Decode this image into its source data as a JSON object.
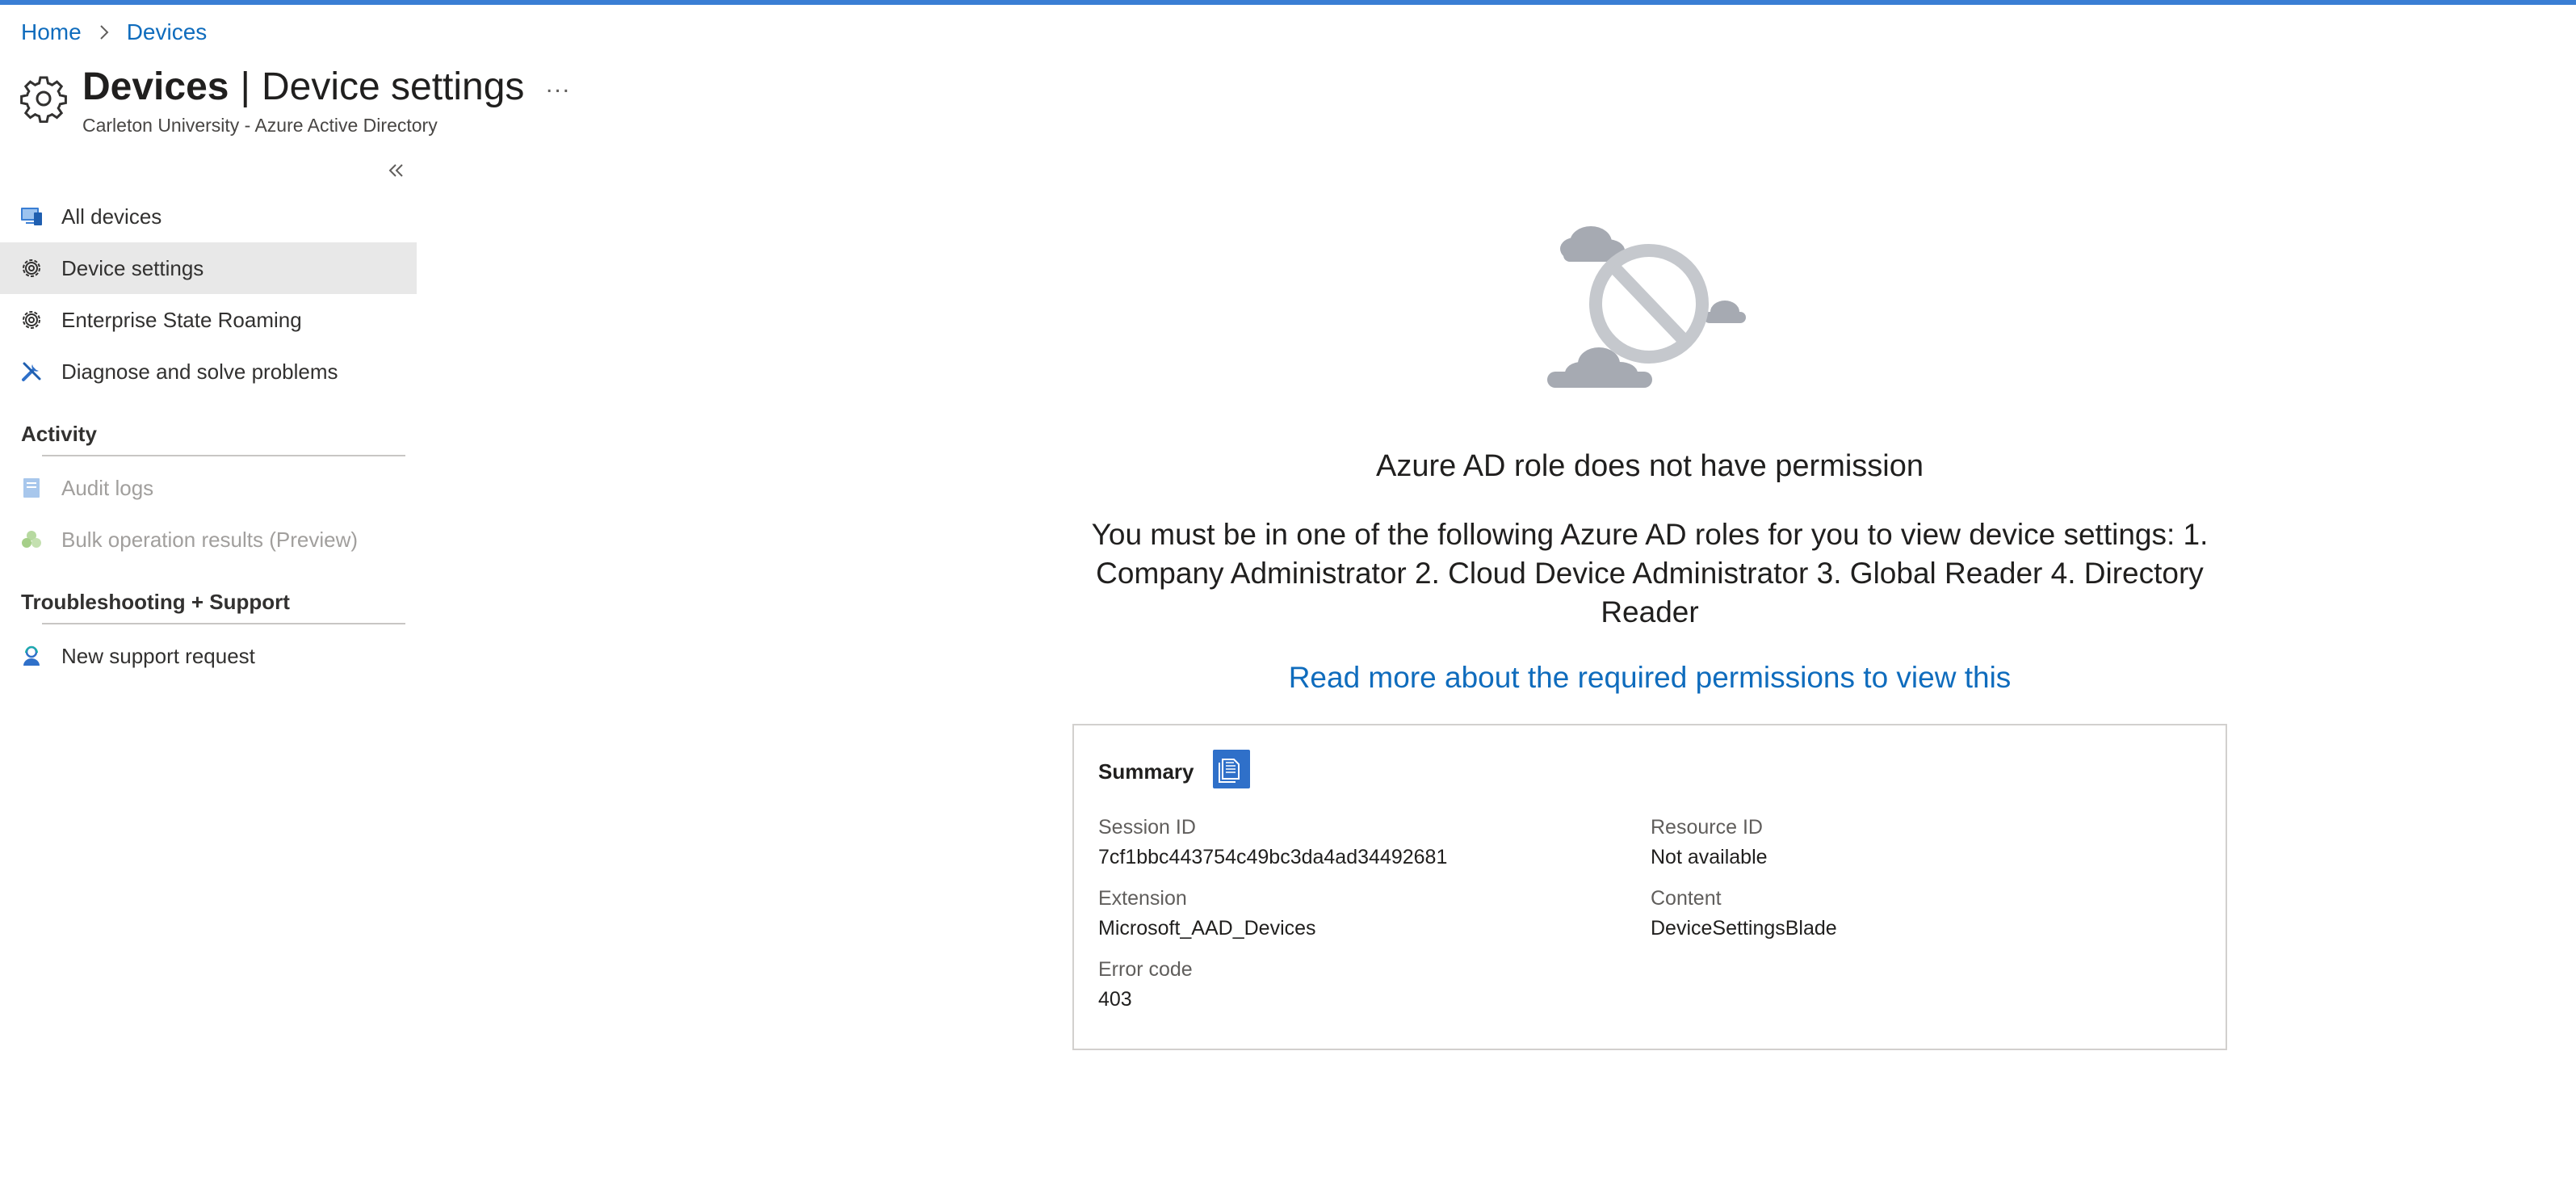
{
  "breadcrumb": {
    "home": "Home",
    "devices": "Devices"
  },
  "header": {
    "title_bold": "Devices",
    "title_sep": "|",
    "title_rest": "Device settings",
    "subtitle": "Carleton University - Azure Active Directory",
    "more": "..."
  },
  "sidebar": {
    "items": [
      {
        "label": "All devices",
        "icon": "devices-icon"
      },
      {
        "label": "Device settings",
        "icon": "gear-icon",
        "active": true
      },
      {
        "label": "Enterprise State Roaming",
        "icon": "gear-icon"
      },
      {
        "label": "Diagnose and solve problems",
        "icon": "wrench-icon"
      }
    ],
    "activity": {
      "heading": "Activity",
      "items": [
        {
          "label": "Audit logs",
          "icon": "audit-log-icon",
          "disabled": true
        },
        {
          "label": "Bulk operation results (Preview)",
          "icon": "bulk-operation-icon",
          "disabled": true
        }
      ]
    },
    "support": {
      "heading": "Troubleshooting + Support",
      "items": [
        {
          "label": "New support request",
          "icon": "support-person-icon"
        }
      ]
    }
  },
  "main": {
    "error_title": "Azure AD role does not have permission",
    "error_body": "You must be in one of the following Azure AD roles for you to view device settings: 1. Company Administrator 2. Cloud Device Administrator 3. Global Reader 4. Directory Reader",
    "link": "Read more about the required permissions to view this",
    "summary": {
      "title": "Summary",
      "session_id_label": "Session ID",
      "session_id": "7cf1bbc443754c49bc3da4ad34492681",
      "resource_id_label": "Resource ID",
      "resource_id": "Not available",
      "extension_label": "Extension",
      "extension": "Microsoft_AAD_Devices",
      "content_label": "Content",
      "content": "DeviceSettingsBlade",
      "error_code_label": "Error code",
      "error_code": "403"
    }
  },
  "colors": {
    "accent": "#0f6cbd",
    "topbar": "#3a7ed4",
    "active_bg": "#e8e8e8"
  }
}
